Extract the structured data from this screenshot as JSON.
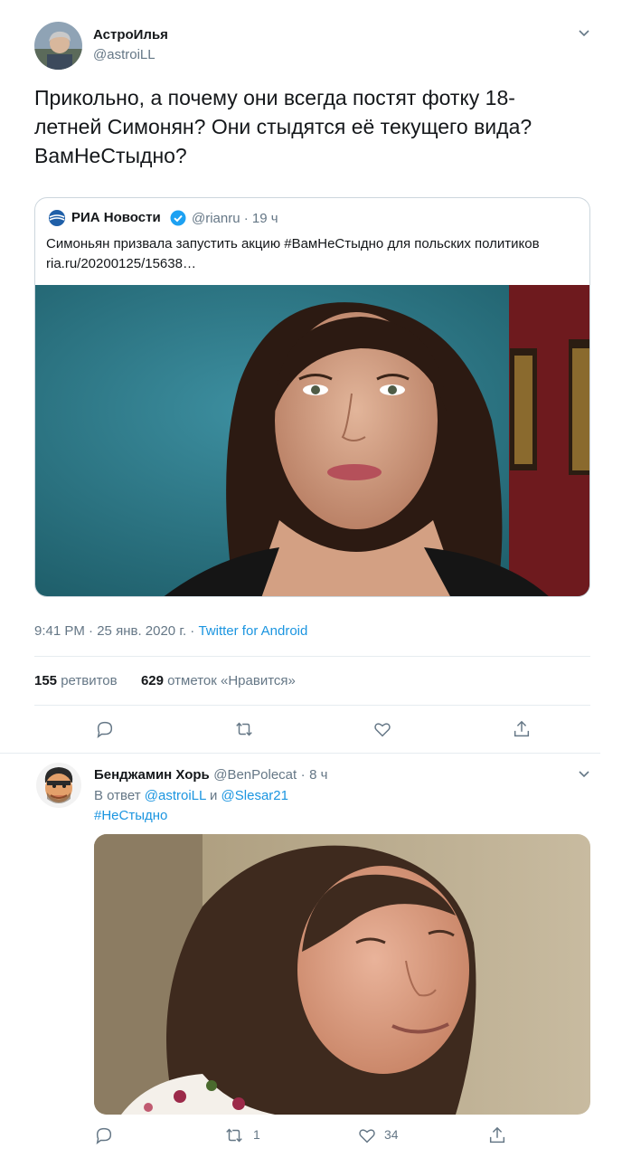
{
  "main_tweet": {
    "author_name": "АстроИлья",
    "author_handle": "@astroiLL",
    "text": "Прикольно, а почему они всегда постят фотку 18-летней Симонян? Они стыдятся её текущего вида? ВамНеСтыдно?",
    "text_lines": [
      "Прикольно, а почему они всегда постят фотку 18-",
      "летней Симонян? Они стыдятся её текущего вида?",
      "ВамНеСтыдно?"
    ],
    "quoted": {
      "name": "РИА Новости",
      "handle": "@rianru",
      "sep": "·",
      "time": "19 ч",
      "text": "Симоньян призвала запустить акцию #ВамНеСтыдно для польских политиков",
      "link": "ria.ru/20200125/15638…"
    },
    "time": "9:41 PM",
    "date": "25 янв. 2020 г.",
    "sep": "·",
    "client": "Twitter for Android",
    "retweets_count": "155",
    "retweets_label": "ретвитов",
    "likes_count": "629",
    "likes_label": "отметок «Нравится»"
  },
  "reply_tweet": {
    "author_name": "Бенджамин Хорь",
    "author_handle": "@BenPolecat",
    "sep": "·",
    "time": "8 ч",
    "reply_prefix": "В ответ",
    "reply_to_1": "@astroiLL",
    "reply_and": "и",
    "reply_to_2": "@Slesar21",
    "text": "#НеСтыдно",
    "retweet_count": "1",
    "like_count": "34"
  },
  "colors": {
    "accent": "#1b95e0",
    "muted": "#657786",
    "text": "#14171a",
    "border": "#e6ecf0"
  },
  "icons": [
    "chevron-down-icon",
    "verified-icon",
    "ria-logo-icon",
    "reply-icon",
    "retweet-icon",
    "like-icon",
    "share-icon"
  ]
}
